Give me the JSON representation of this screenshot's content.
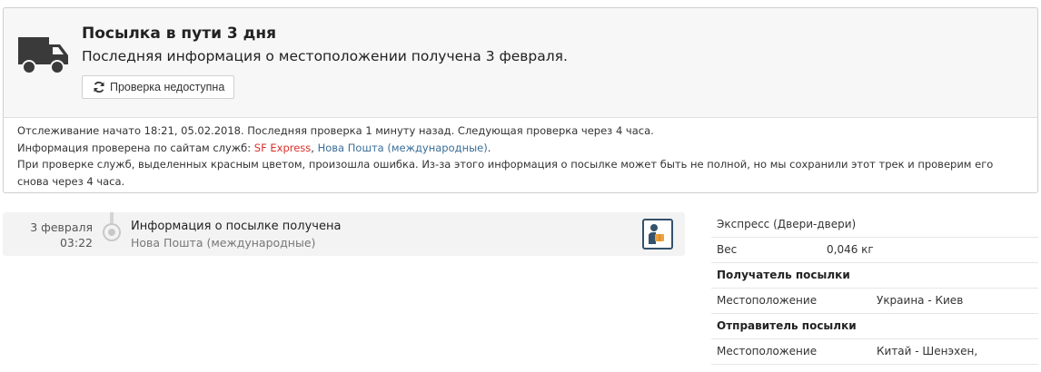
{
  "status": {
    "title": "Посылка в пути 3 дня",
    "subtitle": "Последняя информация о местоположении получена 3 февраля.",
    "check_button": "Проверка недоступна"
  },
  "info": {
    "line1": "Отслеживание начато 18:21, 05.02.2018. Последняя проверка 1 минуту назад. Следующая проверка через 4 часа.",
    "line2_prefix": "Информация проверена по сайтам служб: ",
    "service_error": "SF Express",
    "separator": ", ",
    "service_ok": "Нова Пошта (международные)",
    "line2_suffix": ".",
    "line3": "При проверке служб, выделенных красным цветом, произошла ошибка. Из-за этого информация о посылке может быть не полной, но мы сохранили этот трек и проверим его снова через 4 часа.",
    "error_color": "#d9302c",
    "link_color": "#3b6e98"
  },
  "event": {
    "date": "3 февраля",
    "time": "03:22",
    "title": "Информация о посылке получена",
    "service": "Нова Пошта (международные)",
    "icon": "courier-icon"
  },
  "details": {
    "service_type": "Экспресс (Двери-двери)",
    "weight_label": "Вес",
    "weight_value": "0,046 кг",
    "recipient_header": "Получатель посылки",
    "recipient_location_label": "Местоположение",
    "recipient_location_value": "Украина - Киев",
    "sender_header": "Отправитель посылки",
    "sender_location_label": "Местоположение",
    "sender_location_value": "Китай - Шенэхен,"
  }
}
